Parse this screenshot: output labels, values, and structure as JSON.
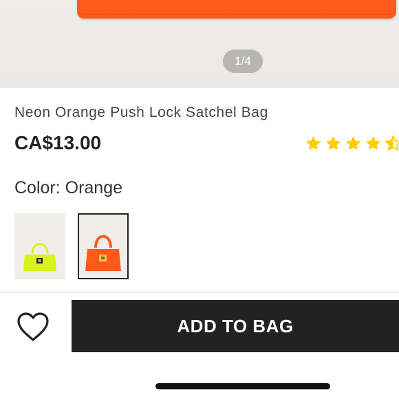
{
  "gallery": {
    "pager": "1/4"
  },
  "product": {
    "title": "Neon Orange Push Lock Satchel Bag",
    "price": "CA$13.00",
    "rating": 4.5,
    "color_label": "Color: Orange"
  },
  "colors": {
    "star": "#ffcc00",
    "neon_yellow": "#d8f21a",
    "orange": "#ff5a1a",
    "button_bg": "#222222"
  },
  "swatches": [
    {
      "name": "Neon Yellow",
      "selected": false
    },
    {
      "name": "Orange",
      "selected": true
    }
  ],
  "actions": {
    "add_to_bag": "ADD TO BAG",
    "wishlist_icon": "heart-icon"
  }
}
